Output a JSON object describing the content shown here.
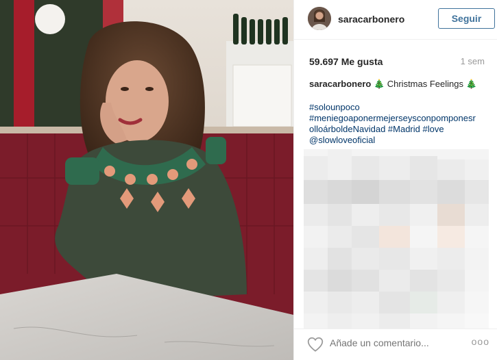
{
  "post": {
    "username": "saracarbonero",
    "follow_label": "Seguir",
    "likes": "59.697 Me gusta",
    "time_ago": "1 sem",
    "caption_user": "saracarbonero",
    "caption_text": " 🎄 Christmas Feelings 🎄",
    "hashtags": [
      "#solounpoco",
      "#meniegoaponermejerseysconpomponesr",
      "olloárboldeNavidad #Madrid #love",
      "@slowloveoficial"
    ],
    "comment_placeholder": "Añade un comentario...",
    "more_label": "ooo"
  },
  "icons": {
    "like": "heart-icon",
    "more": "more-options-icon"
  },
  "colors": {
    "follow_blue": "#3f729b",
    "hashtag_blue": "#003569",
    "muted_gray": "#999999"
  }
}
